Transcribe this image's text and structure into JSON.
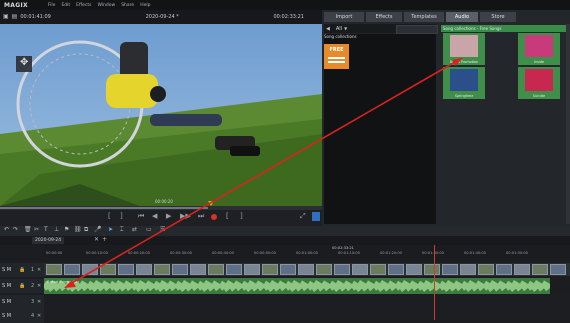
{
  "menubar": {
    "logo": "MAGIX",
    "menus": [
      "File",
      "Edit",
      "Effects",
      "Window",
      "Share",
      "Help"
    ]
  },
  "preview": {
    "timecode_left": "00:01:41:09",
    "project_name": "2020-09-24 *",
    "timecode_right": "00:02:33:21",
    "scrub_timecode": "00:00:20",
    "scrub_position_fraction": 0.65
  },
  "tabs": [
    {
      "label": "Import"
    },
    {
      "label": "Effects"
    },
    {
      "label": "Templates"
    },
    {
      "label": "Audio",
      "active": true
    },
    {
      "label": "Store"
    }
  ],
  "library": {
    "nav_value": "All",
    "section_header": "Song collections",
    "free_tile_label": "FREE"
  },
  "song_collections": {
    "title": "Song collections - Free Songs",
    "items": [
      {
        "label": "Brand Promotion",
        "art_color": "#c9a5a8"
      },
      {
        "label": "Inside",
        "art_color": "#c93a7a"
      },
      {
        "label": "Springtime",
        "art_color": "#2a4f8a"
      },
      {
        "label": "Suicide",
        "art_color": "#c8284f"
      }
    ]
  },
  "timeline": {
    "tab_label": "2020-09-24",
    "ruler_top": "00:02:33:21",
    "ruler_ticks": [
      "00:00:00",
      "00:00:10:00",
      "00:00:20:00",
      "00:00:30:00",
      "00:00:40:00",
      "00:00:50:00",
      "00:01:00:00",
      "00:01:10:00",
      "00:01:20:00",
      "00:01:30:00",
      "00:01:40:00",
      "00:01:50:00"
    ],
    "tracks": [
      {
        "label": "S M",
        "number": "1"
      },
      {
        "label": "S M",
        "number": "2"
      },
      {
        "label": "S M",
        "number": "3"
      },
      {
        "label": "S M",
        "number": "4"
      }
    ],
    "audio_clip_label": "Brand Promotion"
  },
  "colors": {
    "accent": "#3a8c4a",
    "playhead": "#d33a2c",
    "arrow": "#d8231e"
  }
}
